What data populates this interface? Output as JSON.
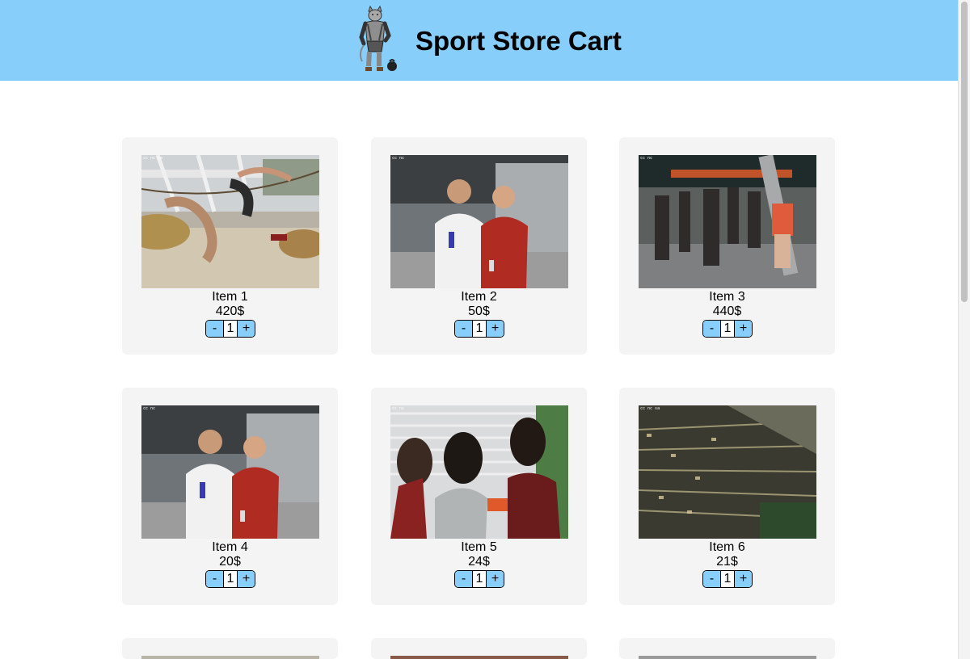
{
  "header": {
    "title": "Sport Store Cart",
    "background": "#87cefa"
  },
  "qty_button_color": "#87cefa",
  "products": [
    {
      "name": "Item 1",
      "price": "420$",
      "quantity": "1",
      "dec_label": "-",
      "inc_label": "+"
    },
    {
      "name": "Item 2",
      "price": "50$",
      "quantity": "1",
      "dec_label": "-",
      "inc_label": "+"
    },
    {
      "name": "Item 3",
      "price": "440$",
      "quantity": "1",
      "dec_label": "-",
      "inc_label": "+"
    },
    {
      "name": "Item 4",
      "price": "20$",
      "quantity": "1",
      "dec_label": "-",
      "inc_label": "+"
    },
    {
      "name": "Item 5",
      "price": "24$",
      "quantity": "1",
      "dec_label": "-",
      "inc_label": "+"
    },
    {
      "name": "Item 6",
      "price": "21$",
      "quantity": "1",
      "dec_label": "-",
      "inc_label": "+"
    }
  ]
}
